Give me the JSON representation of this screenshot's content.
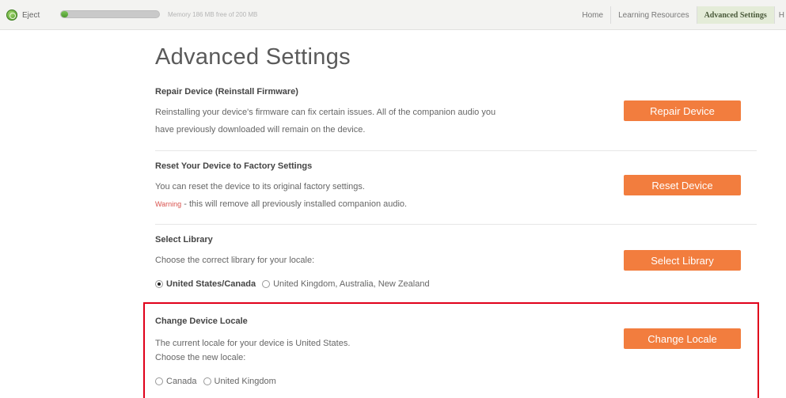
{
  "topbar": {
    "eject_label": "Eject",
    "memory_text": "Memory 186 MB free of 200 MB",
    "memory_used_fraction": 0.07,
    "nav": [
      {
        "label": "Home",
        "active": false
      },
      {
        "label": "Learning Resources",
        "active": false
      },
      {
        "label": "Advanced Settings",
        "active": true
      },
      {
        "label": "H",
        "active": false
      }
    ]
  },
  "page": {
    "title": "Advanced Settings"
  },
  "repair": {
    "title": "Repair Device (Reinstall Firmware)",
    "text_line1": "Reinstalling your device's firmware can fix certain issues. All of the companion audio you",
    "text_line2": "have previously downloaded will remain on the device.",
    "button": "Repair Device"
  },
  "reset": {
    "title": "Reset Your Device to Factory Settings",
    "text_line1": "You can reset the device to its original factory settings.",
    "warning_label": "Warning",
    "warning_text": " - this will remove all previously installed companion audio.",
    "button": "Reset Device"
  },
  "library": {
    "title": "Select Library",
    "text": "Choose the correct library for your locale:",
    "options": [
      {
        "label": "United States/Canada",
        "checked": true
      },
      {
        "label": "United Kingdom, Australia, New Zealand",
        "checked": false
      }
    ],
    "button": "Select Library"
  },
  "locale": {
    "title": "Change Device Locale",
    "text_line1": "The current locale for your device is United States.",
    "text_line2": "Choose the new locale:",
    "options": [
      {
        "label": "Canada",
        "checked": false
      },
      {
        "label": "United Kingdom",
        "checked": false
      }
    ],
    "button": "Change Locale"
  },
  "colors": {
    "accent_orange": "#f27d3e",
    "highlight_red": "#e0001a",
    "active_tab_bg": "#e4ecd8",
    "memory_green": "#4e9a2e"
  }
}
